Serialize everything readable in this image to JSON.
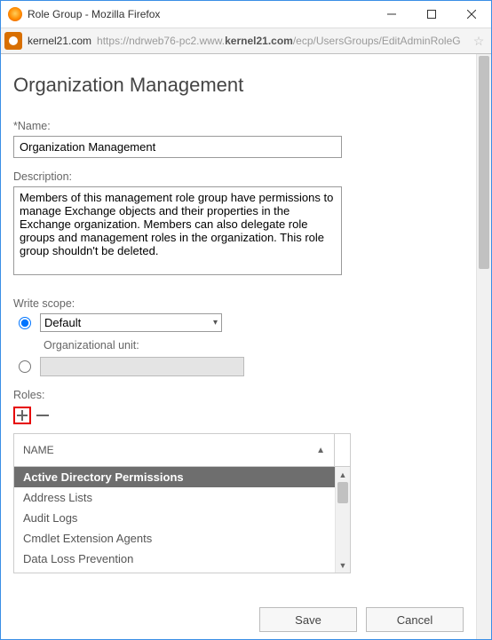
{
  "window": {
    "title": "Role Group - Mozilla Firefox",
    "domain": "kernel21.com",
    "url_prefix": "https://ndrweb76-pc2.www.",
    "url_bold": "kernel21.com",
    "url_suffix": "/ecp/UsersGroups/EditAdminRoleG"
  },
  "page": {
    "title": "Organization Management",
    "name_label": "*Name:",
    "name_value": "Organization Management",
    "desc_label": "Description:",
    "desc_value": "Members of this management role group have permissions to manage Exchange objects and their properties in the Exchange organization. Members can also delegate role groups and management roles in the organization. This role group shouldn't be deleted.",
    "scope_label": "Write scope:",
    "scope_default": "Default",
    "ou_label": "Organizational unit:",
    "roles_label": "Roles:",
    "name_col": "NAME",
    "roles": [
      "Active Directory Permissions",
      "Address Lists",
      "Audit Logs",
      "Cmdlet Extension Agents",
      "Data Loss Prevention"
    ],
    "save": "Save",
    "cancel": "Cancel"
  }
}
